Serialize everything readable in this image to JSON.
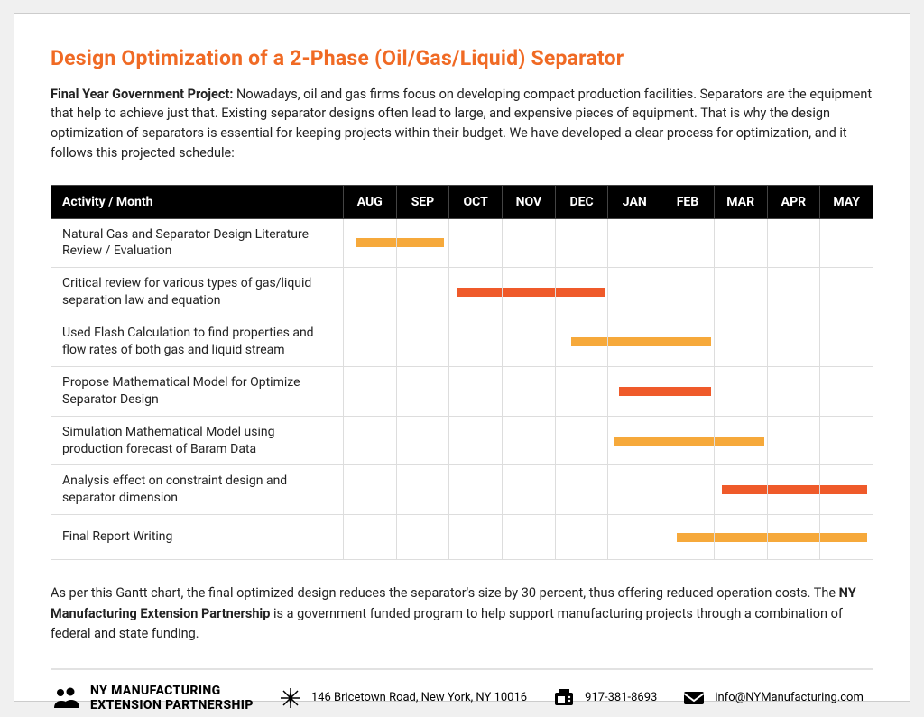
{
  "title": "Design Optimization of a 2-Phase (Oil/Gas/Liquid) Separator",
  "intro_bold": "Final Year Government Project:",
  "intro_text": " Nowadays, oil and gas firms focus on developing compact production facilities. Separators are the equipment that help to achieve just that. Existing separator designs often lead to large, and expensive pieces of equipment. That is why the design optimization of separators is essential for keeping projects within their budget. We have developed a clear process for optimization, and it follows this projected schedule:",
  "table": {
    "header_activity": "Activity / Month",
    "months": [
      "AUG",
      "SEP",
      "OCT",
      "NOV",
      "DEC",
      "JAN",
      "FEB",
      "MAR",
      "APR",
      "MAY"
    ],
    "rows": [
      {
        "activity": "Natural Gas and Separator Design Literature Review / Evaluation",
        "bar": {
          "color": "orange",
          "start": 0,
          "end": 2,
          "start_frac": 0.25,
          "end_frac": 0.1
        }
      },
      {
        "activity": "Critical review for various types of gas/liquid separation law and equation",
        "bar": {
          "color": "red",
          "start": 2,
          "end": 5,
          "start_frac": 0.15,
          "end_frac": 0.05
        }
      },
      {
        "activity": "Used Flash Calculation to find properties and flow rates of both gas and liquid stream",
        "bar": {
          "color": "orange",
          "start": 4,
          "end": 7,
          "start_frac": 0.3,
          "end_frac": 0.05
        }
      },
      {
        "activity": "Propose Mathematical Model for Optimize Separator Design",
        "bar": {
          "color": "red",
          "start": 5,
          "end": 7,
          "start_frac": 0.2,
          "end_frac": 0.05
        }
      },
      {
        "activity": "Simulation Mathematical Model using production forecast of Baram Data",
        "bar": {
          "color": "orange",
          "start": 5,
          "end": 8,
          "start_frac": 0.1,
          "end_frac": 0.05
        }
      },
      {
        "activity": "Analysis effect on constraint design and separator dimension",
        "bar": {
          "color": "red",
          "start": 7,
          "end": 10,
          "start_frac": 0.15,
          "end_frac": 0.1
        }
      },
      {
        "activity": "Final Report Writing",
        "bar": {
          "color": "orange",
          "start": 6,
          "end": 10,
          "start_frac": 0.3,
          "end_frac": 0.1
        }
      }
    ]
  },
  "outro_pre": "As per this Gantt chart, the final optimized design reduces the separator's size by 30 percent, thus offering reduced operation costs. The ",
  "outro_bold": "NY Manufacturing Extension Partnership",
  "outro_post": " is a government funded program to help support manufacturing projects through a combination of federal and state funding.",
  "footer": {
    "org_line1": "NY MANUFACTURING",
    "org_line2": "EXTENSION PARTNERSHIP",
    "address": "146 Bricetown Road, New York, NY 10016",
    "phone": "917-381-8693",
    "email": "info@NYManufacturing.com"
  },
  "chart_data": {
    "type": "gantt",
    "title": "Project Schedule",
    "categories": [
      "AUG",
      "SEP",
      "OCT",
      "NOV",
      "DEC",
      "JAN",
      "FEB",
      "MAR",
      "APR",
      "MAY"
    ],
    "tasks": [
      {
        "name": "Natural Gas and Separator Design Literature Review / Evaluation",
        "start": "AUG",
        "end": "OCT",
        "color": "#f6a93b"
      },
      {
        "name": "Critical review for various types of gas/liquid separation law and equation",
        "start": "OCT",
        "end": "JAN",
        "color": "#ef5a2a"
      },
      {
        "name": "Used Flash Calculation to find properties and flow rates of both gas and liquid stream",
        "start": "DEC",
        "end": "MAR",
        "color": "#f6a93b"
      },
      {
        "name": "Propose Mathematical Model for Optimize Separator Design",
        "start": "JAN",
        "end": "MAR",
        "color": "#ef5a2a"
      },
      {
        "name": "Simulation Mathematical Model using production forecast of Baram Data",
        "start": "JAN",
        "end": "APR",
        "color": "#f6a93b"
      },
      {
        "name": "Analysis effect on constraint design and separator dimension",
        "start": "MAR",
        "end": "MAY",
        "color": "#ef5a2a"
      },
      {
        "name": "Final Report Writing",
        "start": "FEB",
        "end": "MAY",
        "color": "#f6a93b"
      }
    ]
  }
}
